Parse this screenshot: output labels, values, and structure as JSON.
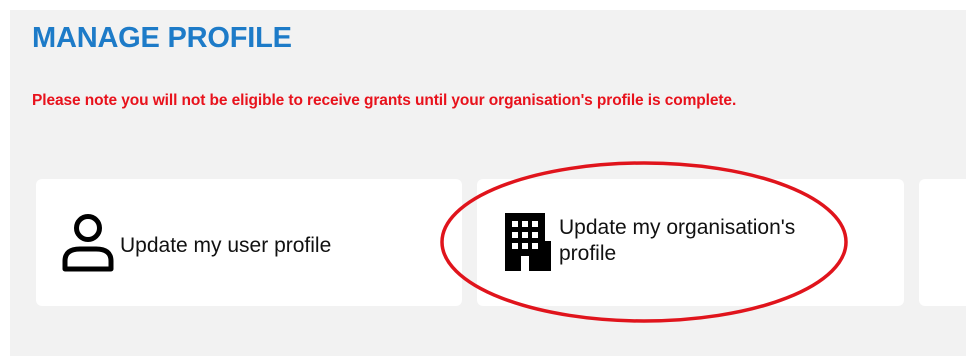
{
  "page": {
    "title": "MANAGE PROFILE",
    "notice": "Please note you will not be eligible to receive grants until your organisation's profile is complete."
  },
  "cards": [
    {
      "label": "Update my user profile",
      "icon": "user-icon"
    },
    {
      "label": "Update my organisation's profile",
      "icon": "building-icon"
    }
  ],
  "colors": {
    "title": "#1d7bc8",
    "notice": "#e8121c",
    "panel_background": "#f2f2f2",
    "card_background": "#ffffff",
    "annotation": "#e0141c"
  }
}
